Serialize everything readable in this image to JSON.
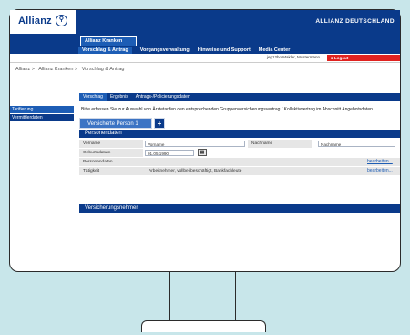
{
  "header": {
    "logo": "Allianz",
    "logo_symbol": "⚲",
    "app_title": "ALLIANZ DEUTSCHLAND",
    "brand_color": "#0a3a8a",
    "accent_color": "#e0221f"
  },
  "tabs": {
    "product": "Allianz Kranken"
  },
  "menu": [
    "Vorschlag & Antrag",
    "Vorgangsverwaltung",
    "Hinweise und Support",
    "Media Center"
  ],
  "userbar": {
    "user": "jep12ho Makler, Mustermann",
    "logout": "Logout"
  },
  "breadcrumb": [
    "Allianz >",
    "Allianz Kranken >",
    "Vorschlag & Antrag"
  ],
  "sidebar": [
    "Tarifierung",
    "Vermittlerdaten"
  ],
  "subtabs": [
    "Vorschlag",
    "Ergebnis",
    "Antrags-/Policierungsdaten"
  ],
  "info_text": "Bitte erfassen Sie zur Auswahl von Ärztetarifen den entsprechenden Gruppenversicherungsvertrag / Kollektivvertrag im Abschnitt Angebotsdaten.",
  "person_tab": {
    "label": "Versicherte Person 1",
    "add": "+"
  },
  "personendaten": {
    "title": "Personendaten",
    "vorname_label": "Vorname",
    "vorname_value": "Vorname",
    "nachname_label": "Nachname",
    "nachname_value": "Nachname",
    "geburt_label": "Geburtsdatum",
    "geburt_value": "01.05.1990",
    "personendaten_label": "Personendaten",
    "personendaten_link": "bearbeiten...",
    "taetigkeit_label": "Tätigkeit",
    "taetigkeit_value": "Arbeitnehmer, vollbeitbeschäftigt, Bankfachleute",
    "taetigkeit_link": "bearbeiten..."
  },
  "versicherungsnehmer": {
    "title": "Versicherungsnehmer"
  }
}
